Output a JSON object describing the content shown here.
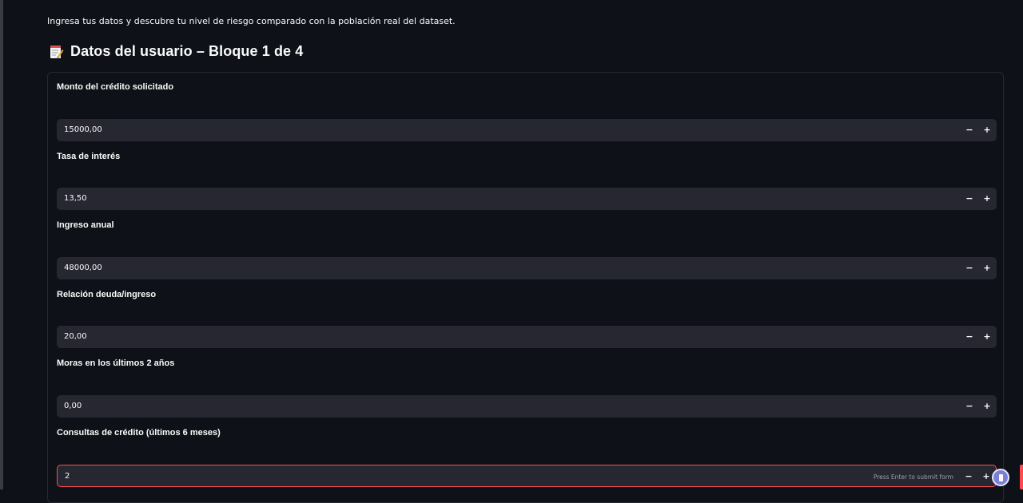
{
  "intro": "Ingresa tus datos y descubre tu nivel de riesgo comparado con la población real del dataset.",
  "form": {
    "title": "Datos del usuario – Bloque 1 de 4",
    "title_icon": "memo-icon",
    "fields": [
      {
        "label": "Monto del crédito solicitado",
        "value": "15000,00"
      },
      {
        "label": "Tasa de interés",
        "value": "13,50"
      },
      {
        "label": "Ingreso anual",
        "value": "48000,00"
      },
      {
        "label": "Relación deuda/ingreso",
        "value": "20,00"
      },
      {
        "label": "Moras en los últimos 2 años",
        "value": "0,00"
      },
      {
        "label": "Consultas de crédito (últimos 6 meses)",
        "value": "2"
      }
    ],
    "stepper": {
      "minus": "−",
      "plus": "+"
    },
    "submit_hint": "Press Enter to submit form"
  },
  "colors": {
    "background": "#0e1117",
    "input_background": "#262730",
    "focus_border": "#ff4b4b",
    "text": "#fafafa"
  }
}
